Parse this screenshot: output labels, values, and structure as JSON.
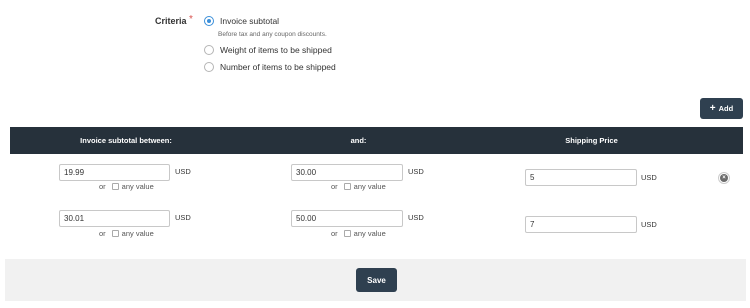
{
  "criteria": {
    "label": "Criteria",
    "required_marker": "*",
    "options": [
      {
        "label": "Invoice subtotal",
        "checked": true
      },
      {
        "label": "Weight of items to be shipped",
        "checked": false
      },
      {
        "label": "Number of items to be shipped",
        "checked": false
      }
    ],
    "help_text": "Before tax and any coupon discounts."
  },
  "add_button": {
    "label": "Add",
    "icon": "plus-icon"
  },
  "table": {
    "headers": [
      "Invoice subtotal between:",
      "and:",
      "Shipping Price"
    ],
    "rows": [
      {
        "from": "19.99",
        "to": "30.00",
        "price": "5"
      },
      {
        "from": "30.01",
        "to": "50.00",
        "price": "7"
      }
    ],
    "currency": "USD",
    "or_text": "or",
    "any_value_text": "any value"
  },
  "save_button": {
    "label": "Save"
  },
  "colors": {
    "accent": "#2f4050",
    "header_bg": "#26313b",
    "radio_selected": "#3b8fd9",
    "required": "#d9534f"
  }
}
